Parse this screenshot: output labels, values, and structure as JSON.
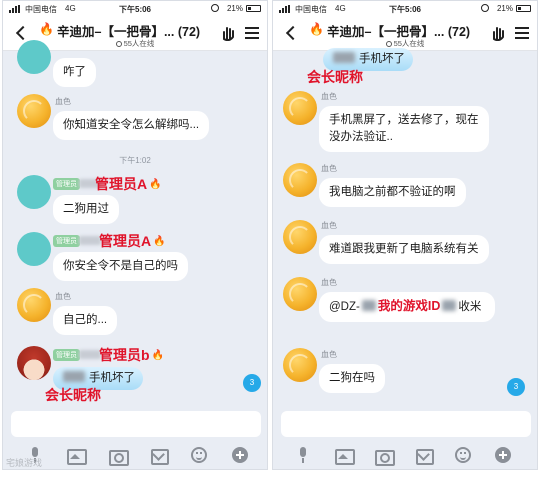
{
  "status_bar": {
    "carrier": "中国电信",
    "network": "4G",
    "time": "下午5:06",
    "battery": "21%"
  },
  "header": {
    "title": "辛迪加–【一把骨】... (72)",
    "online": "55人在线"
  },
  "left": {
    "messages": [
      {
        "text": "咋了"
      },
      {
        "sender": "血色",
        "text": "你知道安全令怎么解绑吗..."
      },
      {
        "timestamp": "下午1:02"
      },
      {
        "badge": "管理员",
        "label": "管理员A",
        "text": "二狗用过"
      },
      {
        "badge": "管理员",
        "label": "管理员A",
        "text": "你安全令不是自己的吗"
      },
      {
        "sender": "血色",
        "text": "自己的..."
      },
      {
        "badge": "管理员",
        "label": "管理员b",
        "text": "手机坏了",
        "annotation": "会长昵称"
      }
    ],
    "unread": "3"
  },
  "right": {
    "messages": [
      {
        "text": "手机坏了",
        "annotation": "会长昵称"
      },
      {
        "sender": "血色",
        "text": "手机黑屏了，送去修了，现在没办法验证.."
      },
      {
        "sender": "血色",
        "text": "我电脑之前都不验证的啊"
      },
      {
        "sender": "血色",
        "text": "难道跟我更新了电脑系统有关"
      },
      {
        "sender": "血色",
        "text_prefix": "@DZ-",
        "annotation": "我的游戏ID",
        "text_suffix": "收米"
      },
      {
        "sender": "血色",
        "text": "二狗在吗"
      }
    ],
    "unread": "3"
  },
  "icons": [
    "mic-icon",
    "image-icon",
    "camera-icon",
    "envelope-icon",
    "emoji-icon",
    "plus-icon"
  ],
  "colors": {
    "annotation_red": "#e0142b",
    "chat_background": "#e9edf4",
    "unread_badge": "#26a9e8",
    "admin_badge": "#8fd0a0"
  },
  "watermark": "宅娘游戏"
}
